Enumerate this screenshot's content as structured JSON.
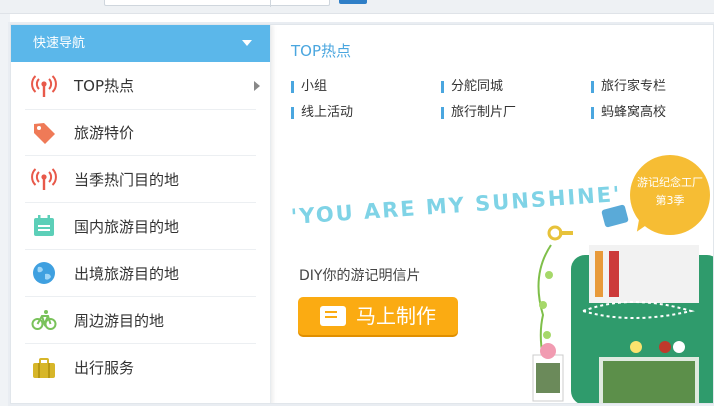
{
  "sidebar": {
    "header": "快速导航",
    "items": [
      {
        "label": "TOP热点",
        "icon": "signal-tower-icon"
      },
      {
        "label": "旅游特价",
        "icon": "price-tag-icon"
      },
      {
        "label": "当季热门目的地",
        "icon": "signal-tower-icon"
      },
      {
        "label": "国内旅游目的地",
        "icon": "calendar-icon"
      },
      {
        "label": "出境旅游目的地",
        "icon": "globe-icon"
      },
      {
        "label": "周边游目的地",
        "icon": "bicycle-icon"
      },
      {
        "label": "出行服务",
        "icon": "suitcase-icon"
      }
    ]
  },
  "content": {
    "title": "TOP热点",
    "links": [
      "小组",
      "分舵同城",
      "旅行家专栏",
      "线上活动",
      "旅行制片厂",
      "蚂蜂窝高校"
    ]
  },
  "banner": {
    "headline": "'YOU ARE MY SUNSHINE'",
    "subtitle": "DIY你的游记明信片",
    "button_label": "马上制作",
    "badge_line1": "游记纪念工厂",
    "badge_line2": "第3季"
  },
  "colors": {
    "accent": "#5bb7ea",
    "link_bar": "#4aa6df",
    "button": "#fbab12",
    "badge": "#f6bd34",
    "sunshine_text": "#7fd3e6"
  }
}
